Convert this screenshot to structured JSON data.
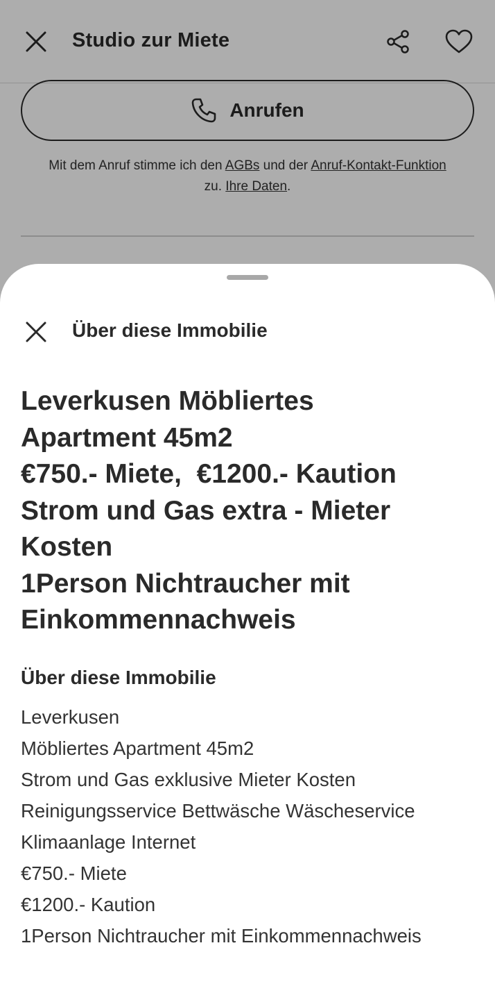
{
  "header": {
    "title": "Studio zur Miete",
    "close_icon": "close-icon",
    "share_icon": "share-icon",
    "favorite_icon": "heart-icon"
  },
  "call": {
    "label": "Anrufen",
    "icon": "phone-icon"
  },
  "legal": {
    "part1": "Mit dem Anruf stimme ich den ",
    "agb_link": "AGBs",
    "part2": " und der ",
    "contact_link": "Anruf-Kontakt-Funktion",
    "part3": " zu. ",
    "data_link": "Ihre Daten",
    "part4": "."
  },
  "sheet": {
    "title": "Über diese Immobilie",
    "headline": [
      "Leverkusen Möbliertes",
      "Apartment 45m2",
      "€750.- Miete,  €1200.- Kaution",
      "Strom und Gas extra - Mieter",
      "Kosten",
      "1Person Nichtraucher mit",
      "Einkommennachweis"
    ],
    "section_heading": "Über diese Immobilie",
    "description": [
      "Leverkusen",
      "Möbliertes Apartment 45m2",
      "Strom und Gas exklusive Mieter Kosten",
      "Reinigungsservice Bettwäsche Wäscheservice",
      "Klimaanlage Internet",
      "€750.- Miete",
      "€1200.- Kaution",
      "1Person Nichtraucher mit Einkommennachweis"
    ]
  },
  "colors": {
    "text": "#2a2a2a",
    "overlay": "rgba(0,0,0,0.32)",
    "grabber": "#a8a8a8"
  }
}
